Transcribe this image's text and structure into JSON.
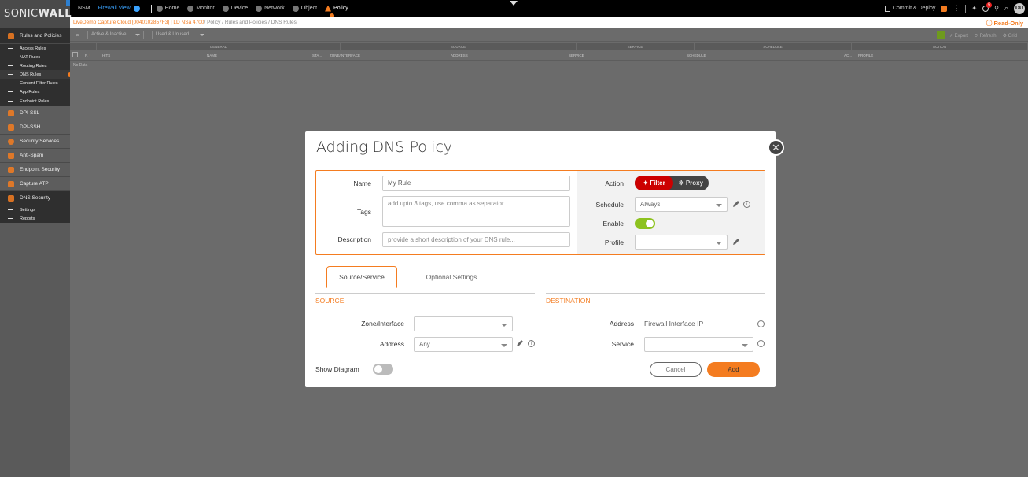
{
  "brand": {
    "logo_light": "SONIC",
    "logo_bold": "WALL"
  },
  "topnav": {
    "nsm": "NSM",
    "firewall_view": "Firewall View",
    "items": [
      {
        "label": "Home",
        "icon": "home-icon"
      },
      {
        "label": "Monitor",
        "icon": "monitor-icon"
      },
      {
        "label": "Device",
        "icon": "device-icon"
      },
      {
        "label": "Network",
        "icon": "network-icon"
      },
      {
        "label": "Object",
        "icon": "object-icon"
      },
      {
        "label": "Policy",
        "icon": "policy-icon"
      }
    ],
    "commit": "Commit & Deploy",
    "notification_count": "6",
    "avatar": "DU"
  },
  "breadcrumb": {
    "device": "LiveDemo Capture Cloud [0040102857F3] | LD NSa 4700",
    "path": " / Policy / Rules and Policies / DNS Rules",
    "read_only": "Read-Only"
  },
  "sidebar": {
    "rules_section": "Rules and Policies",
    "rules_items": [
      "Access Rules",
      "NAT Rules",
      "Routing Rules",
      "DNS Rules",
      "Content Filter Rules",
      "App Rules",
      "Endpoint Rules"
    ],
    "sections": [
      "DPI-SSL",
      "DPI-SSH",
      "Security Services",
      "Anti-Spam",
      "Endpoint Security",
      "Capture ATP"
    ],
    "dns_section": "DNS Security",
    "dns_items": [
      "Settings",
      "Reports"
    ]
  },
  "toolbar": {
    "filter1": "Active & Inactive",
    "filter2": "Used & Unused",
    "export": "Export",
    "refresh": "Refresh",
    "grid": "Grid"
  },
  "table": {
    "groups": [
      "GENERAL",
      "SOURCE",
      "SERVICE",
      "SCHEDULE",
      "ACTION"
    ],
    "columns": [
      "P.",
      "HITS",
      "NAME",
      "STA...",
      "ZONE/INTERFACE",
      "ADDRESS",
      "SERVICE",
      "SCHEDULE",
      "AC...",
      "PROFILE"
    ],
    "empty": "No Data"
  },
  "modal": {
    "title": "Adding DNS Policy",
    "name_label": "Name",
    "name_value": "My Rule",
    "tags_label": "Tags",
    "tags_placeholder": "add upto 3 tags, use comma as separator...",
    "desc_label": "Description",
    "desc_placeholder": "provide a short description of your DNS rule...",
    "action_label": "Action",
    "action_filter": "Filter",
    "action_proxy": "Proxy",
    "schedule_label": "Schedule",
    "schedule_value": "Always",
    "enable_label": "Enable",
    "enable_on": true,
    "profile_label": "Profile",
    "profile_value": "",
    "tabs": [
      "Source/Service",
      "Optional Settings"
    ],
    "source_title": "SOURCE",
    "dest_title": "DESTINATION",
    "zone_label": "Zone/Interface",
    "zone_value": "",
    "src_address_label": "Address",
    "src_address_value": "Any",
    "dst_address_label": "Address",
    "dst_address_value": "Firewall Interface IP",
    "service_label": "Service",
    "service_value": "",
    "show_diagram_label": "Show Diagram",
    "show_diagram_on": false,
    "cancel": "Cancel",
    "add": "Add"
  }
}
